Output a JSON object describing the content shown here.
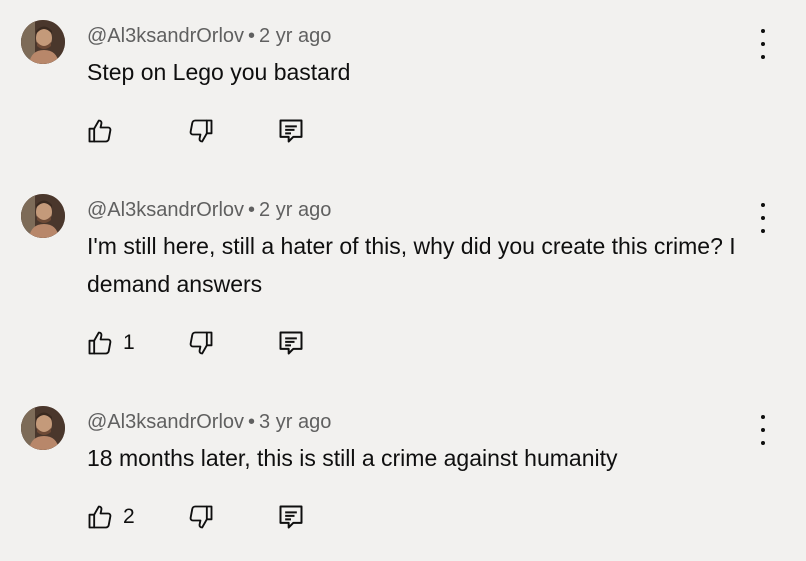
{
  "comments": [
    {
      "author": "@Al3ksandrOrlov",
      "time": "2 yr ago",
      "separator": "•",
      "text": "Step on Lego you bastard",
      "like_count": "",
      "icons": {
        "like": "thumbs-up-icon",
        "dislike": "thumbs-down-icon",
        "reply": "reply-icon",
        "menu": "more-vert-icon"
      }
    },
    {
      "author": "@Al3ksandrOrlov",
      "time": "2 yr ago",
      "separator": "•",
      "text": "I'm still here, still a hater of this, why did you create this crime? I demand answers",
      "like_count": "1",
      "icons": {
        "like": "thumbs-up-icon",
        "dislike": "thumbs-down-icon",
        "reply": "reply-icon",
        "menu": "more-vert-icon"
      }
    },
    {
      "author": "@Al3ksandrOrlov",
      "time": "3 yr ago",
      "separator": "•",
      "text": "18 months later, this is still a crime against humanity",
      "like_count": "2",
      "icons": {
        "like": "thumbs-up-icon",
        "dislike": "thumbs-down-icon",
        "reply": "reply-icon",
        "menu": "more-vert-icon"
      }
    }
  ],
  "colors": {
    "background": "#f2f1ef",
    "text": "#0f0f0f",
    "meta": "#606060"
  }
}
